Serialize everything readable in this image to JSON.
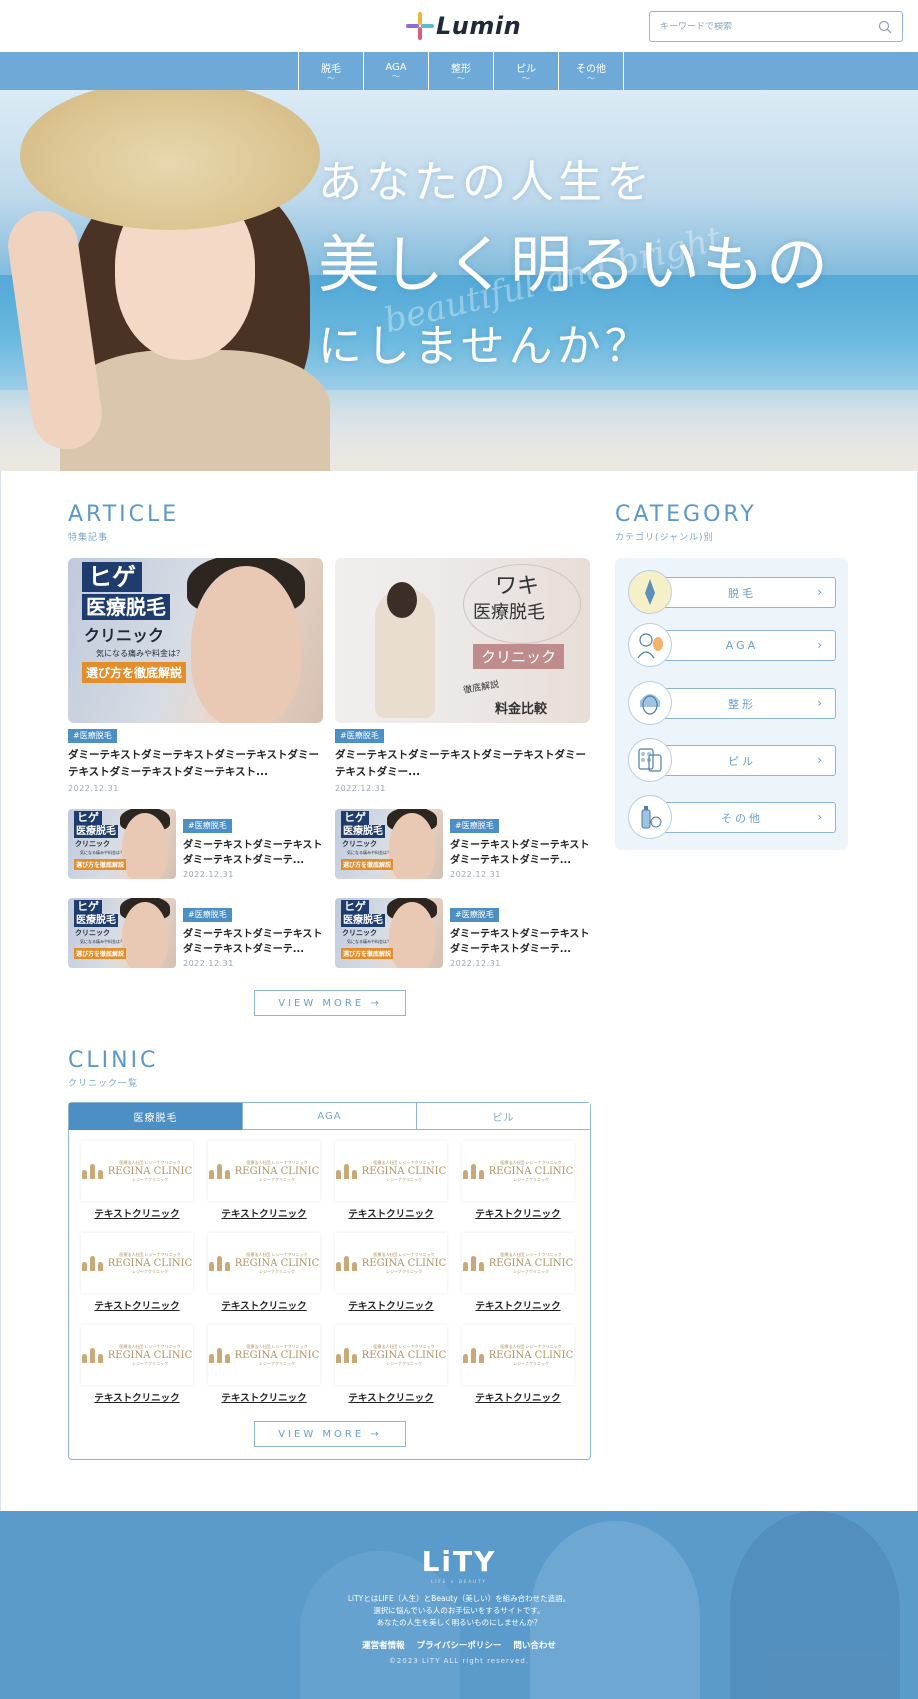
{
  "header": {
    "logo_text": "Lumin",
    "search_placeholder": "キーワードで検索",
    "icons": {
      "logo": "cross-sparkle-icon",
      "search": "search-icon"
    }
  },
  "nav": {
    "items": [
      {
        "label": "脱毛",
        "sub": "〜"
      },
      {
        "label": "AGA",
        "sub": "〜"
      },
      {
        "label": "整形",
        "sub": "〜"
      },
      {
        "label": "ピル",
        "sub": "〜"
      },
      {
        "label": "その他",
        "sub": "〜"
      }
    ]
  },
  "hero": {
    "line1": "あなたの人生を",
    "line2": "美しく明るいもの",
    "line3": "にしませんか？",
    "script": "beautiful and bright"
  },
  "article": {
    "title_en": "ARTICLE",
    "title_ja": "特集記事",
    "featured": [
      {
        "tag": "#医療脱毛",
        "title": "ダミーテキストダミーテキストダミーテキストダミーテキストダミーテキストダミーテキスト...",
        "date": "2022.12.31",
        "thumb": {
          "t1": "ヒゲ",
          "t2": "医療脱毛",
          "t3": "クリニック",
          "t4": "気になる痛みや料金は？",
          "t5": "選び方を徹底解説"
        }
      },
      {
        "tag": "#医療脱毛",
        "title": "ダミーテキストダミーテキストダミーテキストダミーテキストダミー...",
        "date": "2022.12.31",
        "thumb": {
          "w1": "ワキ",
          "w2": "医療脱毛",
          "w3": "クリニック",
          "w4": "徹底解説",
          "w5": "料金比較"
        }
      }
    ],
    "list": [
      {
        "tag": "#医療脱毛",
        "title": "ダミーテキストダミーテキストダミーテキストダミーテ...",
        "date": "2022.12.31"
      },
      {
        "tag": "#医療脱毛",
        "title": "ダミーテキストダミーテキストダミーテキストダミーテ...",
        "date": "2022.12.31"
      },
      {
        "tag": "#医療脱毛",
        "title": "ダミーテキストダミーテキストダミーテキストダミーテ...",
        "date": "2022.12.31"
      },
      {
        "tag": "#医療脱毛",
        "title": "ダミーテキストダミーテキストダミーテキストダミーテ...",
        "date": "2022.12.31"
      }
    ],
    "small_thumb": {
      "t1": "ヒゲ",
      "t2": "医療脱毛",
      "t3": "クリニック",
      "t4": "気になる痛みや料金は？",
      "t5": "選び方を徹底解説"
    },
    "view_more": "VIEW MORE →"
  },
  "category": {
    "title_en": "CATEGORY",
    "title_ja": "カテゴリ(ジャンル)別",
    "items": [
      {
        "label": "脱毛",
        "icon": "razor-icon"
      },
      {
        "label": "AGA",
        "icon": "mirror-man-icon"
      },
      {
        "label": "整形",
        "icon": "face-woman-icon"
      },
      {
        "label": "ピル",
        "icon": "pill-pack-icon"
      },
      {
        "label": "その他",
        "icon": "bottle-icon"
      }
    ]
  },
  "clinic": {
    "title_en": "CLINIC",
    "title_ja": "クリニック一覧",
    "tabs": [
      "医療脱毛",
      "AGA",
      "ピル"
    ],
    "logo_small": "医療法人社団 レジーナクリニック",
    "logo_main": "REGINA CLINIC",
    "logo_foot": "レジーナクリニック",
    "name": "テキストクリニック",
    "view_more": "VIEW MORE →"
  },
  "footer": {
    "logo": "LiTY",
    "sub": "LIFE × BEAUTY",
    "line1": "LiTYとはLIFE（人生）とBeauty（美しい）を組み合わせた造語。",
    "line2": "選択に悩んでいる人のお手伝いをするサイトです。",
    "line3": "あなたの人生を美しく明るいものにしませんか？",
    "links": [
      "運営者情報",
      "プライバシーポリシー",
      "問い合わせ"
    ],
    "copyright": "©2023 LiTY ALL right reserved."
  },
  "colors": {
    "accent": "#4c8fc4",
    "nav": "#6ea9d7",
    "footer": "#5b9bcc",
    "cta_orange": "#e38d2b"
  }
}
